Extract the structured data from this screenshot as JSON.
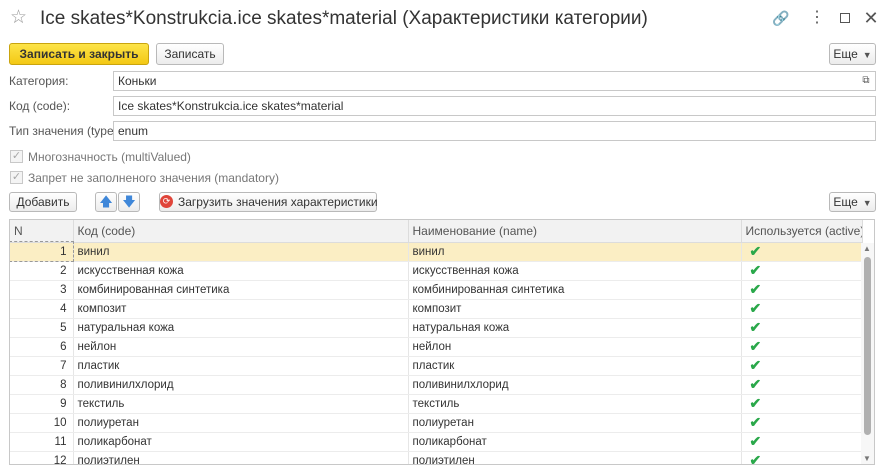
{
  "window": {
    "title": "Ice skates*Konstrukcia.ice skates*material (Характеристики категории)",
    "star_glyph": "☆",
    "link_glyph": "🔗",
    "more_glyph": "⋮",
    "close_glyph": "✕"
  },
  "toolbar": {
    "save_close_label": "Записать и закрыть",
    "save_label": "Записать",
    "more_label": "Еще"
  },
  "form": {
    "category_label": "Категория:",
    "category_value": "Коньки",
    "code_label": "Код (code):",
    "code_value": "Ice skates*Konstrukcia.ice skates*material",
    "type_label": "Тип значения (type):",
    "type_value": "enum",
    "multivalued_label": "Многозначность (multiValued)",
    "multivalued_checked": true,
    "mandatory_label": "Запрет не заполненого значения (mandatory)",
    "mandatory_checked": true
  },
  "values_toolbar": {
    "add_label": "Добавить",
    "up_glyph": "🡅",
    "down_glyph": "🡇",
    "load_label": "Загрузить значения характеристики",
    "more_label": "Еще"
  },
  "table": {
    "columns": [
      "N",
      "Код (code)",
      "Наименование (name)",
      "Используется (active)"
    ],
    "rows": [
      {
        "n": "1",
        "code": "винил",
        "name": "винил",
        "active": "✔"
      },
      {
        "n": "2",
        "code": "искусственная кожа",
        "name": "искусственная кожа",
        "active": "✔"
      },
      {
        "n": "3",
        "code": "комбинированная синтетика",
        "name": "комбинированная синтетика",
        "active": "✔"
      },
      {
        "n": "4",
        "code": "композит",
        "name": "композит",
        "active": "✔"
      },
      {
        "n": "5",
        "code": "натуральная кожа",
        "name": "натуральная кожа",
        "active": "✔"
      },
      {
        "n": "6",
        "code": "нейлон",
        "name": "нейлон",
        "active": "✔"
      },
      {
        "n": "7",
        "code": "пластик",
        "name": "пластик",
        "active": "✔"
      },
      {
        "n": "8",
        "code": "поливинилхлорид",
        "name": "поливинилхлорид",
        "active": "✔"
      },
      {
        "n": "9",
        "code": "текстиль",
        "name": "текстиль",
        "active": "✔"
      },
      {
        "n": "10",
        "code": "полиуретан",
        "name": "полиуретан",
        "active": "✔"
      },
      {
        "n": "11",
        "code": "поликарбонат",
        "name": "поликарбонат",
        "active": "✔"
      },
      {
        "n": "12",
        "code": "полиэтилен",
        "name": "полиэтилен",
        "active": "✔"
      }
    ],
    "selected_row": 0
  },
  "colors": {
    "primary_button": "#f3c814",
    "selected_row": "#fbeec4",
    "check": "#2aa84a"
  }
}
